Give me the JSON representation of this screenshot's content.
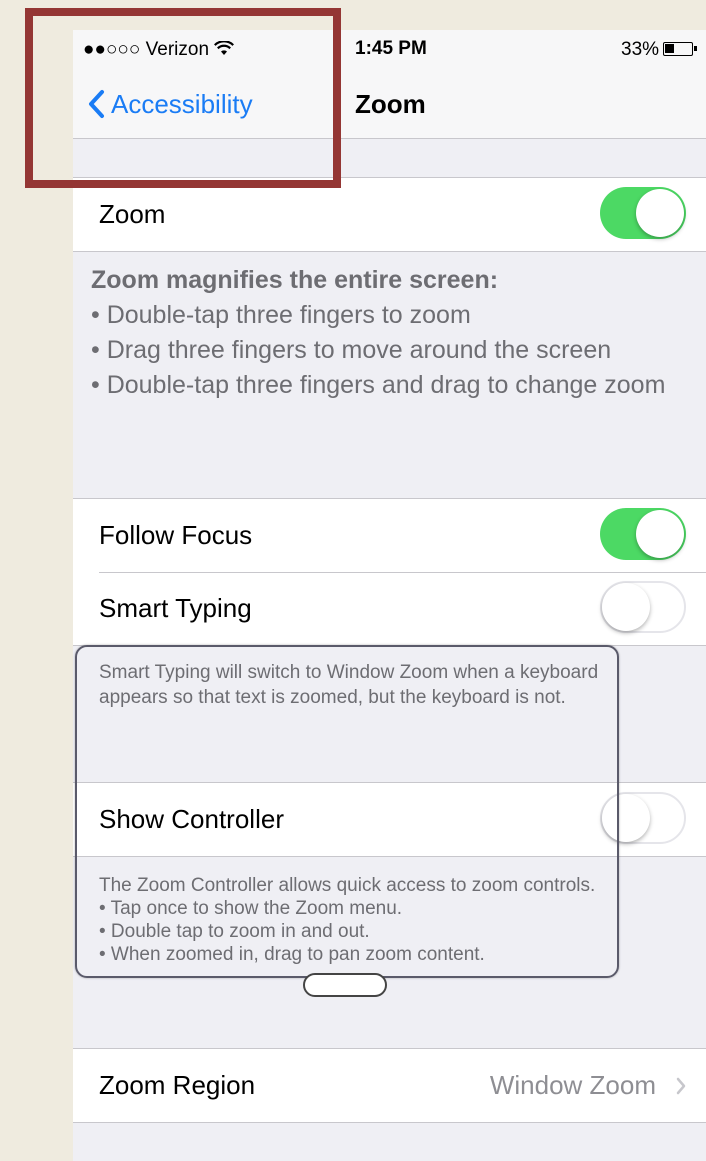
{
  "status_bar": {
    "carrier": "●●○○○ Verizon",
    "time": "1:45 PM",
    "battery": "33%"
  },
  "nav": {
    "back_label": "Accessibility",
    "title": "Zoom"
  },
  "zoom_cell": {
    "label": "Zoom",
    "state": "on"
  },
  "zoom_footer": {
    "heading": "Zoom magnifies the entire screen:",
    "lines": [
      "• Double-tap three fingers to zoom",
      "• Drag three fingers to move around the screen",
      "• Double-tap three fingers and drag to change zoom"
    ]
  },
  "follow_focus": {
    "label": "Follow Focus",
    "state": "on"
  },
  "smart_typing": {
    "label": "Smart Typing",
    "state": "off"
  },
  "smart_typing_footer": "Smart Typing will switch to Window Zoom when a keyboard appears so that text is zoomed, but the keyboard is not.",
  "show_controller": {
    "label": "Show Controller",
    "state": "off"
  },
  "controller_footer": {
    "lines": [
      "The Zoom Controller allows quick access to zoom controls.",
      "• Tap once to show the Zoom menu.",
      "• Double tap to zoom in and out.",
      "• When zoomed in, drag to pan zoom content."
    ]
  },
  "zoom_region": {
    "label": "Zoom Region",
    "value": "Window Zoom"
  },
  "colors": {
    "ios_blue": "#1a7cf5",
    "switch_on": "#4cd964",
    "annotation": "#943634"
  }
}
